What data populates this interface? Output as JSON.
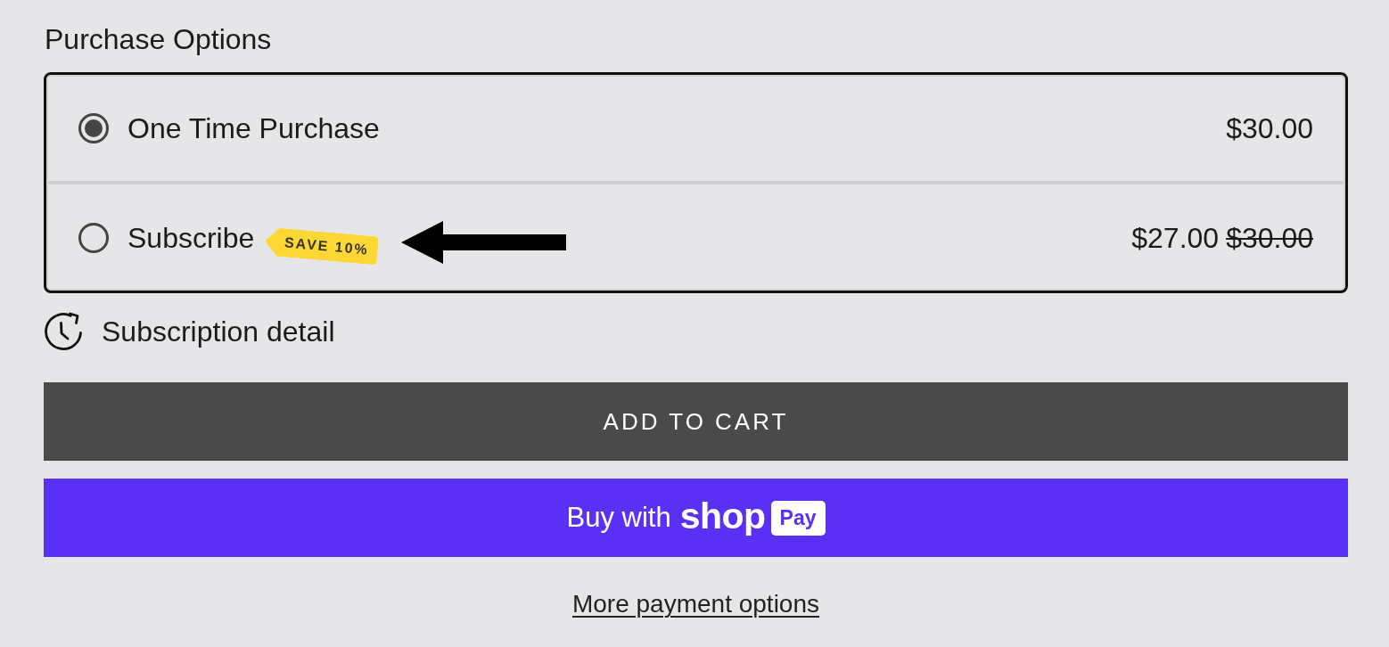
{
  "heading": "Purchase Options",
  "options": [
    {
      "label": "One Time Purchase",
      "selected": true,
      "price": "$30.00",
      "pointer_arrow": false
    },
    {
      "label": "Subscribe",
      "selected": false,
      "badge": "SAVE 10%",
      "price": "$27.00",
      "compare_price": "$30.00",
      "pointer_arrow": true
    }
  ],
  "subscription_link": "Subscription detail",
  "add_to_cart_button": "ADD TO CART",
  "shop_pay_button": {
    "prefix": "Buy with",
    "wordmark": "shop",
    "tag": "Pay"
  },
  "more_options_link": "More payment options"
}
